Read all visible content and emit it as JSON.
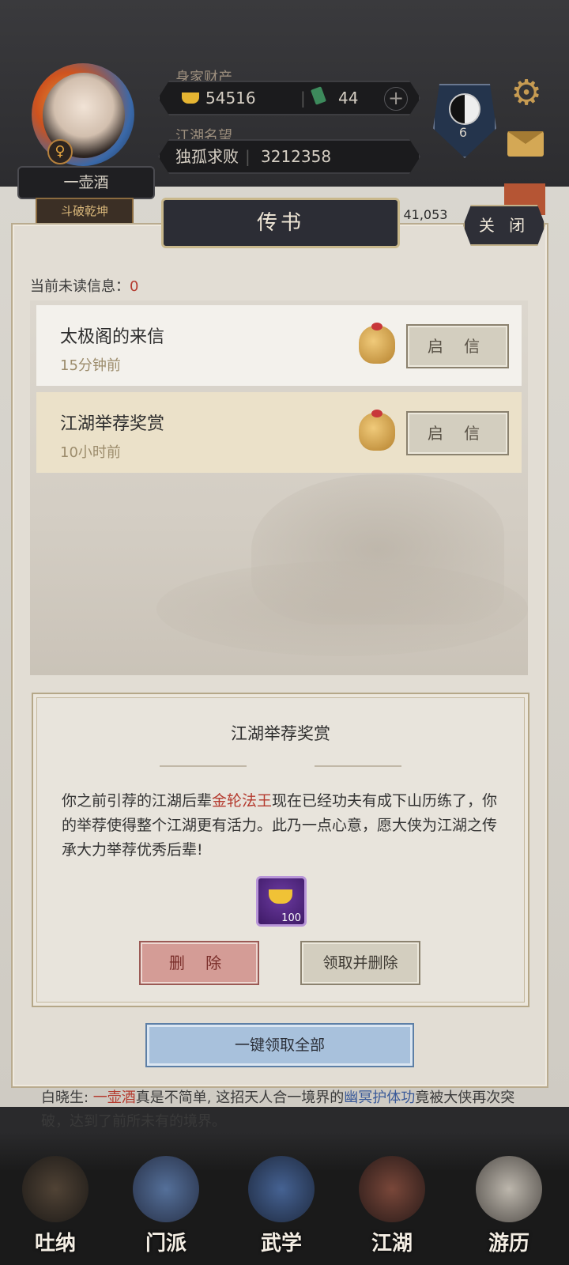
{
  "profile": {
    "wealth_label": "身家财产",
    "gold": "54516",
    "jade": "44",
    "plus": "+",
    "reputation_label": "江湖名望",
    "rank_title": "独孤求败",
    "reputation_value": "3212358",
    "name": "一壶酒",
    "title": "斗破乾坤",
    "gender_symbol": "♀",
    "level": "6",
    "behind_text": "共: 41,053"
  },
  "dialog": {
    "title": "传书",
    "close_label": "关 闭",
    "unread_label": "当前未读信息：",
    "unread_count": "0",
    "messages": [
      {
        "title": "太极阁的来信",
        "time": "15分钟前",
        "action": "启 信"
      },
      {
        "title": "江湖举荐奖赏",
        "time": "10小时前",
        "action": "启 信"
      }
    ],
    "detail": {
      "title": "江湖举荐奖赏",
      "body_pre": "你之前引荐的江湖后辈",
      "body_highlight": "金轮法王",
      "body_post": "现在已经功夫有成下山历练了，你的举荐使得整个江湖更有活力。此乃一点心意，愿大侠为江湖之传承大力举荐优秀后辈!",
      "reward_qty": "100",
      "delete_label": "删 除",
      "claim_delete_label": "领取并删除"
    },
    "claim_all_label": "一键领取全部"
  },
  "chat": {
    "speaker": "白晓生: ",
    "name": "一壶酒",
    "text1": "真是不简单, 这招天人合一境界的",
    "skill": "幽冥护体功",
    "text2": "竟被大侠再次突破，达到了前所未有的境界。"
  },
  "nav": [
    {
      "label": "吐纳",
      "icon": "meditation-icon"
    },
    {
      "label": "门派",
      "icon": "sect-icon"
    },
    {
      "label": "武学",
      "icon": "martial-arts-icon"
    },
    {
      "label": "江湖",
      "icon": "jianghu-icon"
    },
    {
      "label": "游历",
      "icon": "travel-icon"
    }
  ],
  "colors": {
    "accent_red": "#b43a2e",
    "gold_frame": "#c9b88c",
    "claim_all_blue": "#a8c1dc"
  }
}
